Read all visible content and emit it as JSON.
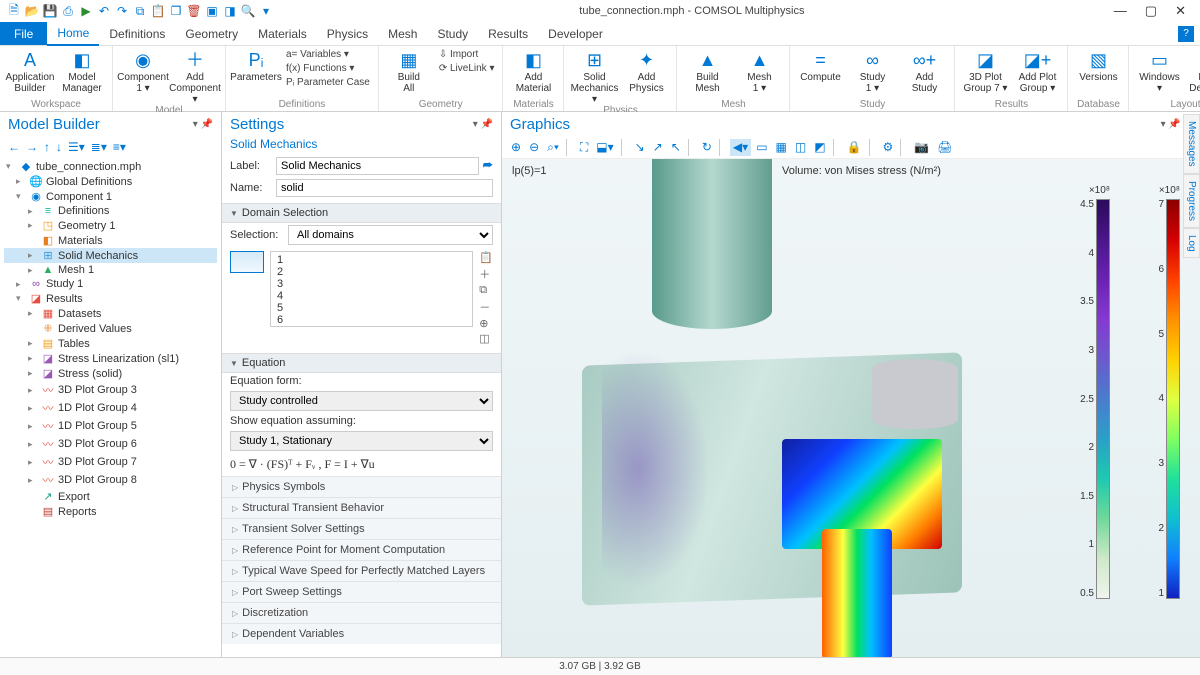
{
  "title": "tube_connection.mph - COMSOL Multiphysics",
  "qat": [
    "new",
    "open",
    "save",
    "save-as",
    "run",
    "undo",
    "redo",
    "copy",
    "paste",
    "duplicate",
    "delete",
    "move-up",
    "move-down",
    "search",
    "grid"
  ],
  "menu": {
    "file": "File",
    "tabs": [
      "Home",
      "Definitions",
      "Geometry",
      "Materials",
      "Physics",
      "Mesh",
      "Study",
      "Results",
      "Developer"
    ]
  },
  "ribbon": {
    "workspace": {
      "label": "Workspace",
      "btns": [
        {
          "k": "app_builder",
          "l1": "Application",
          "l2": "Builder",
          "ic": "A"
        },
        {
          "k": "model_manager",
          "l1": "Model",
          "l2": "Manager",
          "ic": "◧"
        }
      ]
    },
    "model": {
      "label": "Model",
      "btns": [
        {
          "k": "component",
          "l1": "Component",
          "l2": "1 ▾",
          "ic": "◉"
        },
        {
          "k": "add_component",
          "l1": "Add",
          "l2": "Component ▾",
          "ic": "＋"
        }
      ]
    },
    "definitions": {
      "label": "Definitions",
      "btns": [
        {
          "k": "parameters",
          "l1": "Parameters",
          "l2": "",
          "ic": "Pᵢ"
        }
      ],
      "small": [
        "a= Variables ▾",
        "f(x) Functions ▾",
        "Pᵢ Parameter Case"
      ]
    },
    "geometry": {
      "label": "Geometry",
      "btns": [
        {
          "k": "build_all",
          "l1": "Build",
          "l2": "All",
          "ic": "▦"
        }
      ],
      "small": [
        "⇩ Import",
        "⟳ LiveLink ▾"
      ]
    },
    "materials": {
      "label": "Materials",
      "btns": [
        {
          "k": "add_material",
          "l1": "Add",
          "l2": "Material",
          "ic": "◧"
        }
      ]
    },
    "physics": {
      "label": "Physics",
      "btns": [
        {
          "k": "solid_mech",
          "l1": "Solid",
          "l2": "Mechanics ▾",
          "ic": "⊞"
        },
        {
          "k": "add_physics",
          "l1": "Add",
          "l2": "Physics",
          "ic": "✦"
        }
      ]
    },
    "mesh": {
      "label": "Mesh",
      "btns": [
        {
          "k": "build_mesh",
          "l1": "Build",
          "l2": "Mesh",
          "ic": "▲"
        },
        {
          "k": "mesh1",
          "l1": "Mesh",
          "l2": "1 ▾",
          "ic": "▲"
        }
      ]
    },
    "study": {
      "label": "Study",
      "btns": [
        {
          "k": "compute",
          "l1": "Compute",
          "l2": "",
          "ic": "="
        },
        {
          "k": "study1",
          "l1": "Study",
          "l2": "1 ▾",
          "ic": "∞"
        },
        {
          "k": "add_study",
          "l1": "Add",
          "l2": "Study",
          "ic": "∞+"
        }
      ]
    },
    "results": {
      "label": "Results",
      "btns": [
        {
          "k": "3dplot",
          "l1": "3D Plot",
          "l2": "Group 7 ▾",
          "ic": "◪"
        },
        {
          "k": "add_plot",
          "l1": "Add Plot",
          "l2": "Group ▾",
          "ic": "◪+"
        }
      ]
    },
    "database": {
      "label": "Database",
      "btns": [
        {
          "k": "versions",
          "l1": "Versions",
          "l2": "",
          "ic": "▧"
        }
      ]
    },
    "layout": {
      "label": "Layout",
      "btns": [
        {
          "k": "windows",
          "l1": "Windows",
          "l2": "▾",
          "ic": "▭"
        },
        {
          "k": "reset",
          "l1": "Reset",
          "l2": "Desktop ▾",
          "ic": "↺"
        }
      ]
    }
  },
  "panels": {
    "model_builder_title": "Model Builder",
    "settings_title": "Settings",
    "graphics_title": "Graphics"
  },
  "tree": [
    {
      "d": 0,
      "exp": "▾",
      "ic": "◆",
      "lbl": "tube_connection.mph",
      "cls": ""
    },
    {
      "d": 1,
      "exp": "▸",
      "ic": "🌐",
      "lbl": "Global Definitions",
      "c": "#c0392b"
    },
    {
      "d": 1,
      "exp": "▾",
      "ic": "◉",
      "lbl": "Component 1",
      "c": "#0078d4"
    },
    {
      "d": 2,
      "exp": "▸",
      "ic": "≡",
      "lbl": "Definitions",
      "c": "#1abc9c"
    },
    {
      "d": 2,
      "exp": "▸",
      "ic": "◳",
      "lbl": "Geometry 1",
      "c": "#f39c12"
    },
    {
      "d": 2,
      "exp": "",
      "ic": "◧",
      "lbl": "Materials",
      "c": "#e67e22"
    },
    {
      "d": 2,
      "exp": "▸",
      "ic": "⊞",
      "lbl": "Solid Mechanics",
      "sel": true,
      "c": "#3498db"
    },
    {
      "d": 2,
      "exp": "▸",
      "ic": "▲",
      "lbl": "Mesh 1",
      "c": "#27ae60"
    },
    {
      "d": 1,
      "exp": "▸",
      "ic": "∞",
      "lbl": "Study 1",
      "c": "#8e44ad"
    },
    {
      "d": 1,
      "exp": "▾",
      "ic": "◪",
      "lbl": "Results",
      "c": "#e74c3c"
    },
    {
      "d": 2,
      "exp": "▸",
      "ic": "▦",
      "lbl": "Datasets",
      "c": "#e74c3c"
    },
    {
      "d": 2,
      "exp": "",
      "ic": "⁜",
      "lbl": "Derived Values",
      "c": "#e67e22"
    },
    {
      "d": 2,
      "exp": "▸",
      "ic": "▤",
      "lbl": "Tables",
      "c": "#f39c12"
    },
    {
      "d": 2,
      "exp": "▸",
      "ic": "◪",
      "lbl": "Stress Linearization (sl1)",
      "c": "#9b59b6"
    },
    {
      "d": 2,
      "exp": "▸",
      "ic": "◪",
      "lbl": "Stress (solid)",
      "c": "#9b59b6"
    },
    {
      "d": 2,
      "exp": "▸",
      "ic": "〰",
      "lbl": "3D Plot Group 3",
      "c": "#e74c3c"
    },
    {
      "d": 2,
      "exp": "▸",
      "ic": "〰",
      "lbl": "1D Plot Group 4",
      "c": "#e74c3c"
    },
    {
      "d": 2,
      "exp": "▸",
      "ic": "〰",
      "lbl": "1D Plot Group 5",
      "c": "#e74c3c"
    },
    {
      "d": 2,
      "exp": "▸",
      "ic": "〰",
      "lbl": "3D Plot Group 6",
      "c": "#e74c3c"
    },
    {
      "d": 2,
      "exp": "▸",
      "ic": "〰",
      "lbl": "3D Plot Group 7",
      "c": "#e74c3c"
    },
    {
      "d": 2,
      "exp": "▸",
      "ic": "〰",
      "lbl": "3D Plot Group 8",
      "c": "#e74c3c"
    },
    {
      "d": 2,
      "exp": "",
      "ic": "↗",
      "lbl": "Export",
      "c": "#16a085"
    },
    {
      "d": 2,
      "exp": "",
      "ic": "▤",
      "lbl": "Reports",
      "c": "#c0392b"
    }
  ],
  "settings": {
    "subtitle": "Solid Mechanics",
    "label_lbl": "Label:",
    "label_val": "Solid Mechanics",
    "name_lbl": "Name:",
    "name_val": "solid",
    "domain_sel_head": "Domain Selection",
    "selection_lbl": "Selection:",
    "selection_val": "All domains",
    "domains": [
      "1",
      "2",
      "3",
      "4",
      "5",
      "6"
    ],
    "equation_head": "Equation",
    "eq_form_lbl": "Equation form:",
    "eq_form_val": "Study controlled",
    "show_eq_lbl": "Show equation assuming:",
    "show_eq_val": "Study 1, Stationary",
    "formula": "0 = ∇ · (FS)ᵀ + Fᵥ ,   F = I + ∇u",
    "collapsed": [
      "Physics Symbols",
      "Structural Transient Behavior",
      "Transient Solver Settings",
      "Reference Point for Moment Computation",
      "Typical Wave Speed for Perfectly Matched Layers",
      "Port Sweep Settings",
      "Discretization",
      "Dependent Variables"
    ]
  },
  "graphics": {
    "lp_label": "lp(5)=1",
    "vol_label": "Volume: von Mises stress (N/m²)",
    "cb1": {
      "title": "×10⁸",
      "ticks": [
        "4.5",
        "4",
        "3.5",
        "3",
        "2.5",
        "2",
        "1.5",
        "1",
        "0.5"
      ]
    },
    "cb2": {
      "title": "×10⁸",
      "ticks": [
        "7",
        "6",
        "5",
        "4",
        "3",
        "2",
        "1"
      ]
    }
  },
  "side_tabs": [
    "Messages",
    "Progress",
    "Log"
  ],
  "status": "3.07 GB | 3.92 GB"
}
